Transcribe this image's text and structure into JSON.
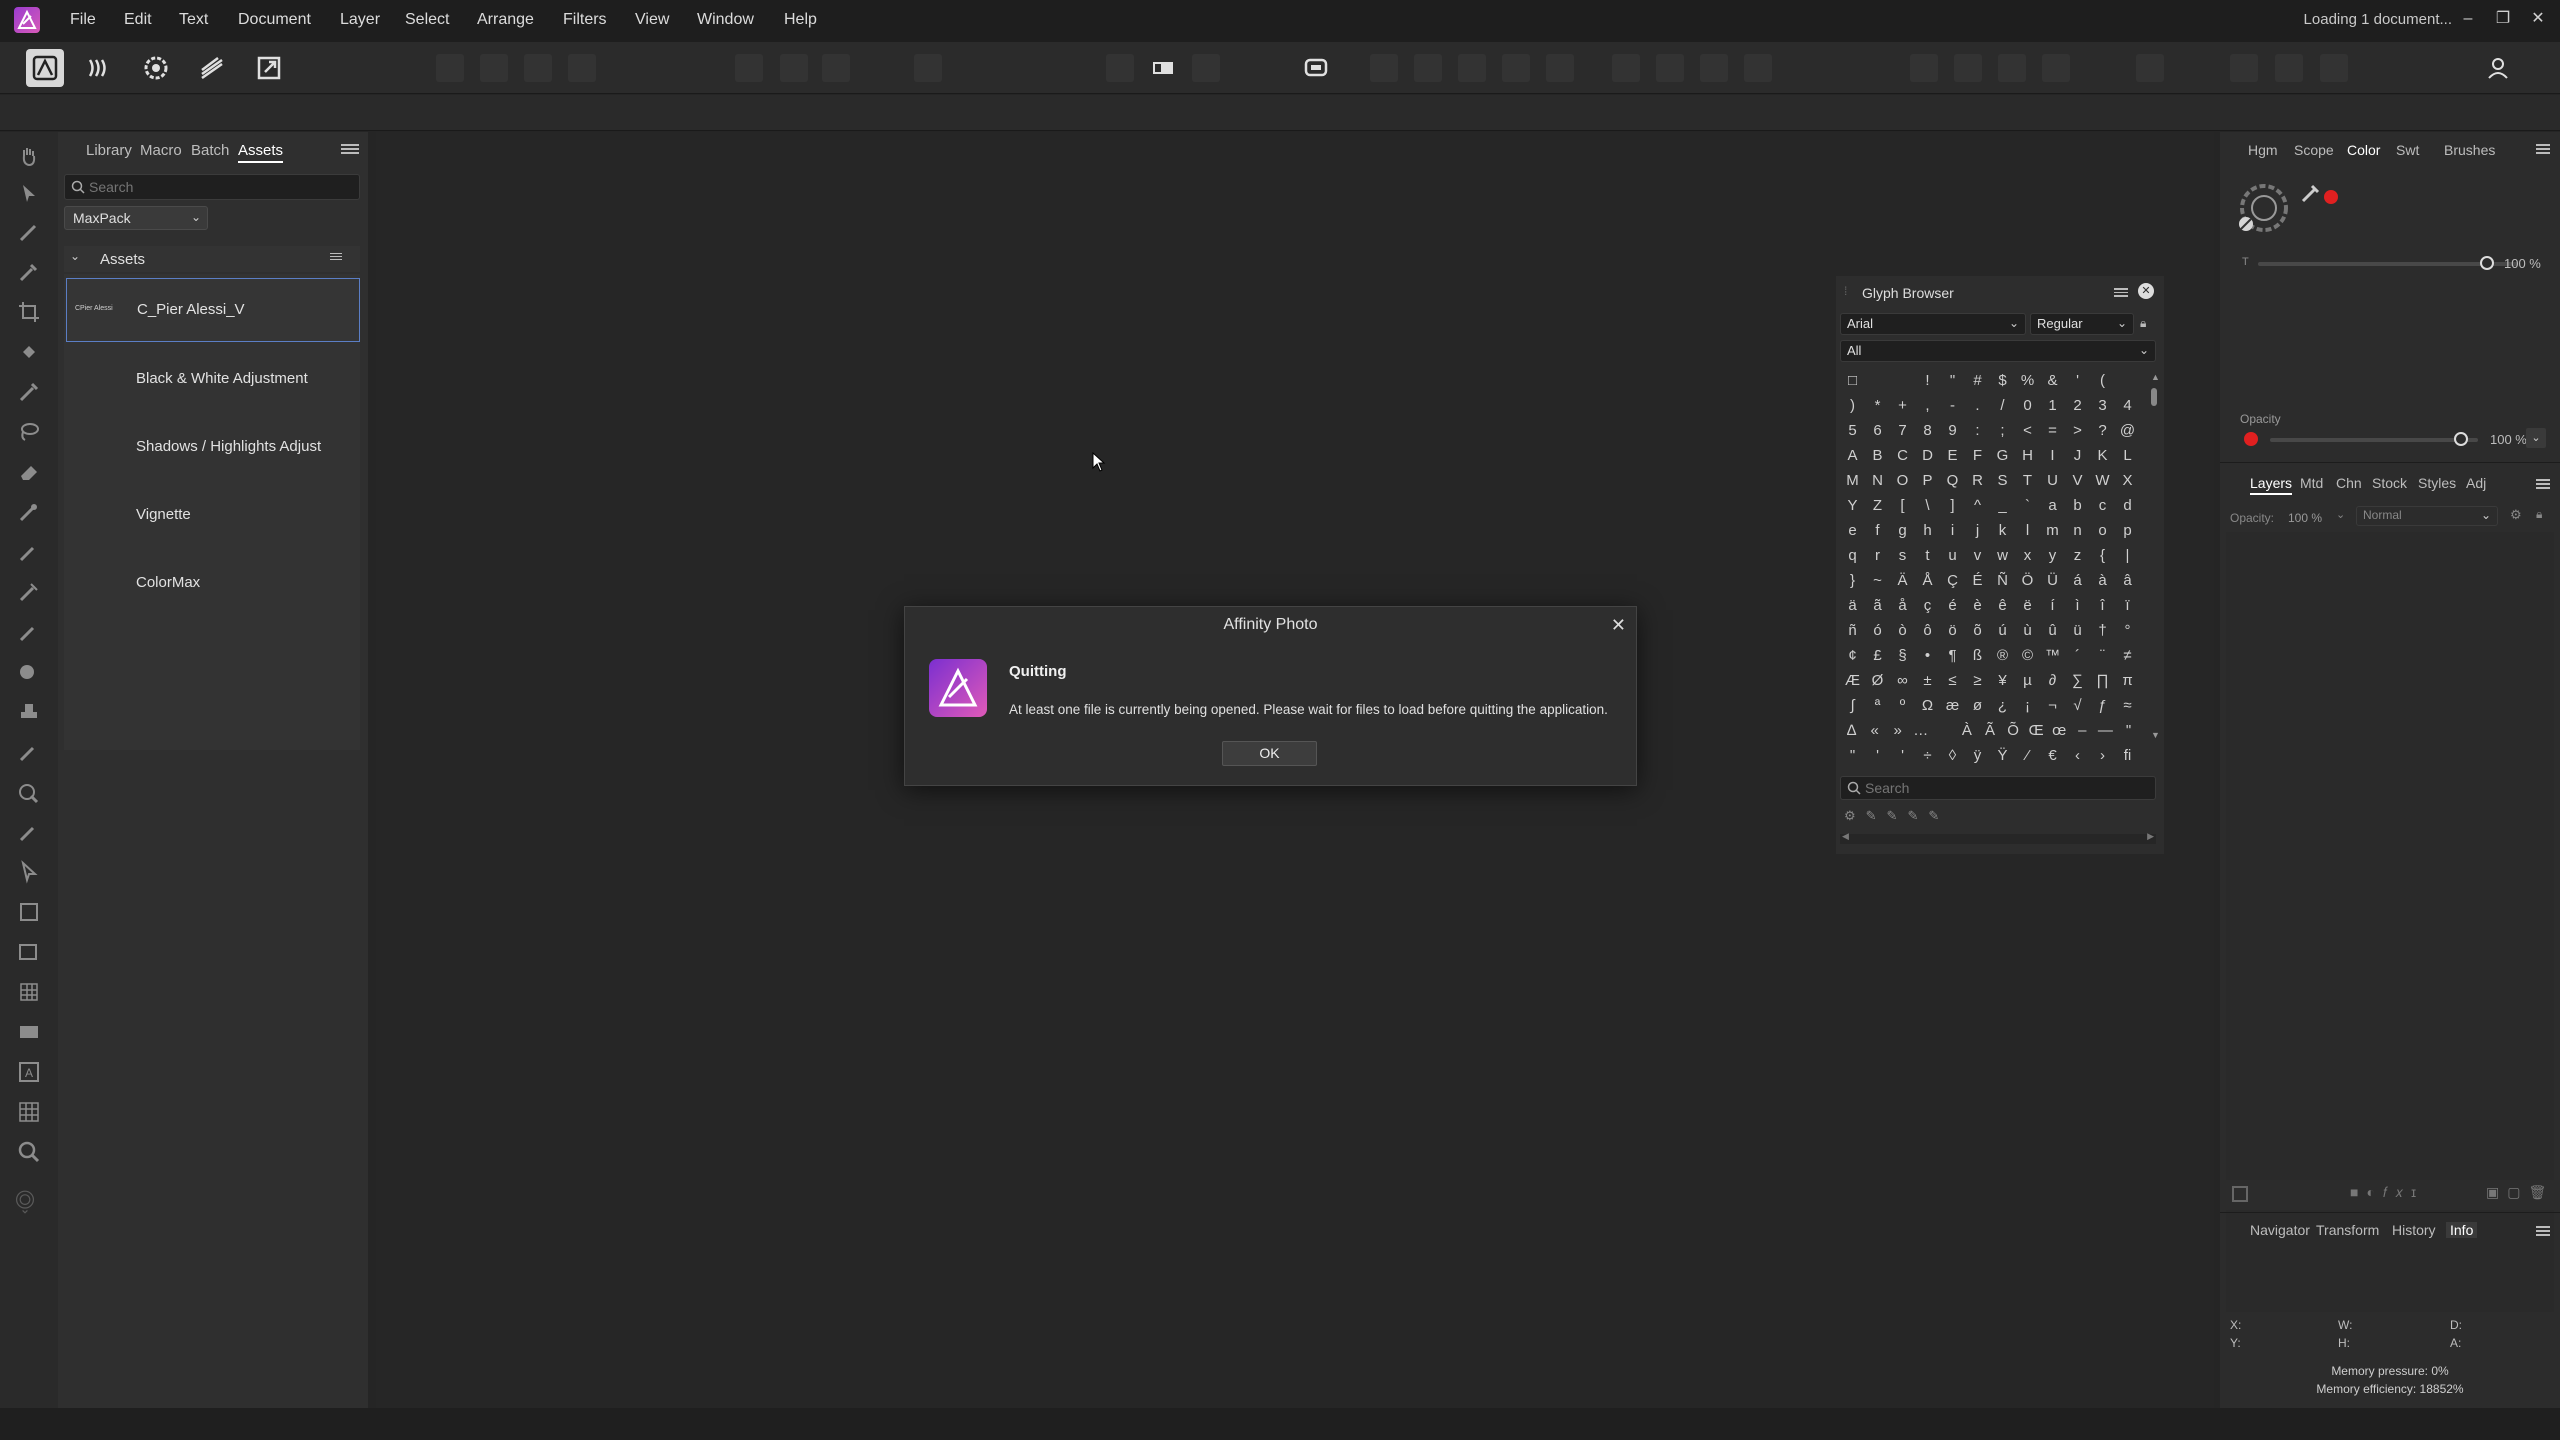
{
  "menubar": {
    "items": [
      "File",
      "Edit",
      "Text",
      "Document",
      "Layer",
      "Select",
      "Arrange",
      "Filters",
      "View",
      "Window",
      "Help"
    ],
    "status": "Loading 1 document...",
    "window_controls": {
      "minimize": "–",
      "restore": "❐",
      "close": "✕"
    }
  },
  "left_studio": {
    "tabs": [
      "Library",
      "Macro",
      "Batch",
      "Assets"
    ],
    "active_tab": "Assets",
    "search_placeholder": "Search",
    "category_dropdown": "MaxPack",
    "section_title": "Assets",
    "assets": [
      {
        "label": "C_Pier Alessi_V",
        "thumb": "CPier Alessi",
        "selected": true
      },
      {
        "label": "Black & White Adjustment"
      },
      {
        "label": "Shadows / Highlights Adjust"
      },
      {
        "label": "Vignette"
      },
      {
        "label": "ColorMax"
      }
    ]
  },
  "dialog": {
    "title": "Affinity Photo",
    "heading": "Quitting",
    "message": "At least one file is currently being opened. Please wait for files to load before quitting the application.",
    "ok_label": "OK",
    "close_glyph": "✕"
  },
  "glyph_browser": {
    "title": "Glyph Browser",
    "font": "Arial",
    "style": "Regular",
    "subset": "All",
    "search_placeholder": "Search",
    "rows": [
      [
        "□",
        " ",
        " ",
        "!",
        "\"",
        "#",
        "$",
        "%",
        "&",
        "'",
        "("
      ],
      [
        ")",
        "*",
        "+",
        ",",
        "-",
        ".",
        "/",
        "0",
        "1",
        "2",
        "3",
        "4"
      ],
      [
        "5",
        "6",
        "7",
        "8",
        "9",
        ":",
        ";",
        "<",
        "=",
        ">",
        "?",
        "@"
      ],
      [
        "A",
        "B",
        "C",
        "D",
        "E",
        "F",
        "G",
        "H",
        "I",
        "J",
        "K",
        "L"
      ],
      [
        "M",
        "N",
        "O",
        "P",
        "Q",
        "R",
        "S",
        "T",
        "U",
        "V",
        "W",
        "X"
      ],
      [
        "Y",
        "Z",
        "[",
        "\\",
        "]",
        "^",
        "_",
        "`",
        "a",
        "b",
        "c",
        "d"
      ],
      [
        "e",
        "f",
        "g",
        "h",
        "i",
        "j",
        "k",
        "l",
        "m",
        "n",
        "o",
        "p"
      ],
      [
        "q",
        "r",
        "s",
        "t",
        "u",
        "v",
        "w",
        "x",
        "y",
        "z",
        "{",
        "|"
      ],
      [
        "}",
        "~",
        "Ä",
        "Å",
        "Ç",
        "É",
        "Ñ",
        "Ö",
        "Ü",
        "á",
        "à",
        "â"
      ],
      [
        "ä",
        "ã",
        "å",
        "ç",
        "é",
        "è",
        "ê",
        "ë",
        "í",
        "ì",
        "î",
        "ï"
      ],
      [
        "ñ",
        "ó",
        "ò",
        "ô",
        "ö",
        "õ",
        "ú",
        "ù",
        "û",
        "ü",
        "†",
        "°"
      ],
      [
        "¢",
        "£",
        "§",
        "•",
        "¶",
        "ß",
        "®",
        "©",
        "™",
        "´",
        "¨",
        "≠"
      ],
      [
        "Æ",
        "Ø",
        "∞",
        "±",
        "≤",
        "≥",
        "¥",
        "µ",
        "∂",
        "∑",
        "∏",
        "π"
      ],
      [
        "∫",
        "ª",
        "º",
        "Ω",
        "æ",
        "ø",
        "¿",
        "¡",
        "¬",
        "√",
        "ƒ",
        "≈"
      ],
      [
        "∆",
        "«",
        "»",
        "…",
        " ",
        "À",
        "Ã",
        "Õ",
        "Œ",
        "œ",
        "–",
        "—",
        "\""
      ],
      [
        "\"",
        "'",
        "'",
        "÷",
        "◊",
        "ÿ",
        "Ÿ",
        "⁄",
        "€",
        "‹",
        "›",
        "ﬁ"
      ]
    ]
  },
  "right_studio": {
    "top_tabs": [
      "Hgm",
      "Scope",
      "Color",
      "Swt",
      "Brushes"
    ],
    "active_top_tab": "Color",
    "tint_label": "T",
    "tint_value": "100 %",
    "opacity_label": "Opacity",
    "opacity_value": "100 %",
    "layer_tabs": [
      "Layers",
      "Mtd",
      "Chn",
      "Stock",
      "Styles",
      "Adj"
    ],
    "active_layer_tab": "Layers",
    "layer_opacity_label": "Opacity:",
    "layer_opacity_value": "100 %",
    "blend_mode": "Normal",
    "bottom_tabs": [
      "Navigator",
      "Transform",
      "History",
      "Info"
    ],
    "active_bottom_tab": "Info",
    "info_labels": {
      "x": "X:",
      "y": "Y:",
      "w": "W:",
      "h": "H:",
      "d": "D:",
      "a": "A:"
    },
    "memory_pressure": "Memory pressure: 0%",
    "memory_efficiency": "Memory efficiency: 18852%"
  },
  "colors": {
    "accent": "#5b7ec5",
    "brand_purple": "#9a3ccf",
    "color_red": "#e02020"
  }
}
